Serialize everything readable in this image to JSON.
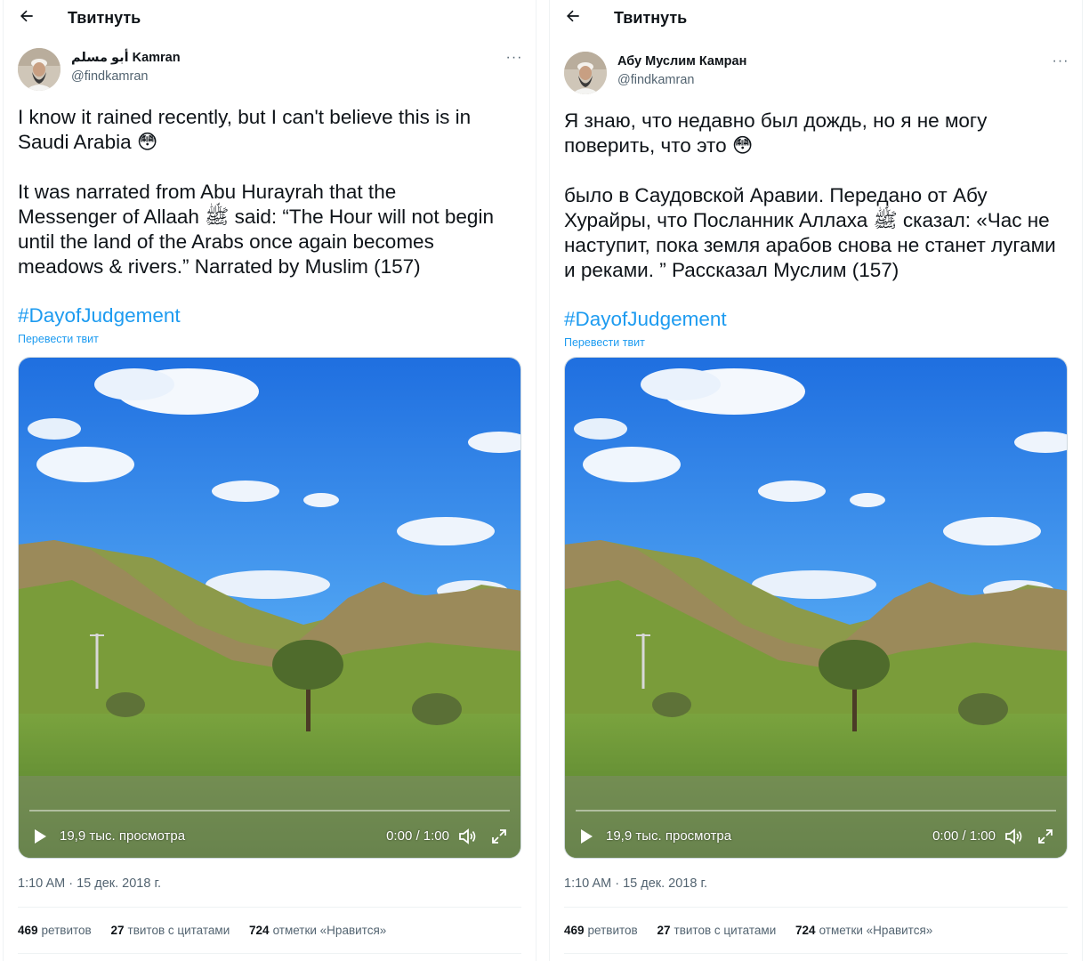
{
  "left": {
    "header_title": "Твитнуть",
    "author_name": "أبو مسلم Kamran",
    "author_handle": "@findkamran",
    "text": "I know it rained recently, but I can't believe this is in\nSaudi Arabia 😳\n\nIt was narrated from Abu Hurayrah that the\nMessenger of Allaah ﷺ said: “The Hour will not begin\nuntil the land of the Arabs once again becomes\nmeadows & rivers.” Narrated by Muslim (157)",
    "hashtag": "#DayofJudgement",
    "translate": "Перевести твит",
    "video_views": "19,9 тыс. просмотра",
    "video_time": "0:00 / 1:00",
    "timestamp": "1:10 AM · 15 дек. 2018 г.",
    "retweets_count": "469",
    "retweets_label": "ретвитов",
    "quotes_count": "27",
    "quotes_label": "твитов с цитатами",
    "likes_count": "724",
    "likes_label": "отметки «Нравится»"
  },
  "right": {
    "header_title": "Твитнуть",
    "author_name": "Абу Муслим Камран",
    "author_handle": "@findkamran",
    "text": "Я знаю, что недавно был дождь, но я не могу\nповерить, что это 😳\n\nбыло в Саудовской Аравии. Передано от Абу\nХурайры, что Посланник Аллаха ﷺ сказал: «Час не\nнаступит, пока земля арабов снова не станет лугами\nи реками. ” Рассказал Муслим (157)",
    "hashtag": " #DayofJudgement",
    "translate": "Перевести твит",
    "video_views": "19,9 тыс. просмотра",
    "video_time": "0:00 / 1:00",
    "timestamp": "1:10 AM · 15 дек. 2018 г.",
    "retweets_count": "469",
    "retweets_label": "ретвитов",
    "quotes_count": "27",
    "quotes_label": "твитов с цитатами",
    "likes_count": "724",
    "likes_label": "отметки «Нравится»"
  },
  "colors": {
    "accent": "#1d9bf0",
    "text_primary": "#0f1419",
    "text_secondary": "#536471"
  },
  "icons": [
    "back-arrow-icon",
    "more-icon",
    "play-icon",
    "volume-icon",
    "fullscreen-icon"
  ]
}
